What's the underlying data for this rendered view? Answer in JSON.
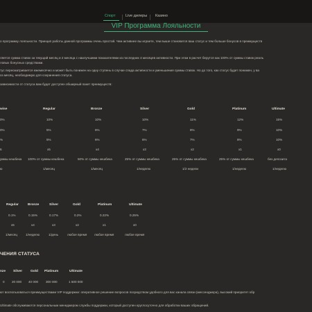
{
  "nav": {
    "items": [
      {
        "label": "Спорт",
        "active": true
      },
      {
        "label": "Live дилеры",
        "active": false
      },
      {
        "label": "Казино",
        "active": false
      }
    ]
  },
  "page": {
    "title": "VIP Программа Лояльности",
    "intro": "о программу лояльности. Принцип работы данной программы очень простой. Чем активнее вы играете, тем выше становится ваш статус и тем больше бонусов в преимуществ",
    "para2_line1": "ляется сумма ставок за текущий месяц и 2 месяца с наилучшими показателями из последних 4 месяцев активности. При этом в расчет берутся как 100% от суммы ставок реаль",
    "para2_line2": "ловых бонусных средствами.",
    "para3_line1": "тус пересматривается ежемесячно и может быть понижен на одну ступень в случае спада активности и уменьшения суммы ставок. Но до того, как статус будет понижен, у ва",
    "para3_line2": "оз месяц, необходимую для сохранения статуса.",
    "para4": "зависимости от статуса вам будет доступен обширный пакет преимуществ:"
  },
  "table1": {
    "headers": [
      "wise",
      "Regular",
      "Bronze",
      "Silver",
      "Gold",
      "Platinum",
      "Ultimate"
    ],
    "rows": [
      [
        "0%",
        "10%",
        "10%",
        "10%",
        "11%",
        "12%",
        "15%"
      ],
      [
        "0%",
        "5%",
        "6%",
        "7%",
        "8%",
        "9%",
        "10%"
      ],
      [
        "%",
        "5%",
        "6%",
        "6%",
        "7%",
        "8%",
        "10%"
      ],
      [
        "6",
        "x5",
        "x4",
        "x3",
        "x2",
        "x1",
        "x0"
      ],
      [
        "уммы кешбека",
        "100% от суммы кешбека",
        "50% от суммы кешбека",
        "25% от суммы кешбека",
        "25% от суммы кешбека",
        "25% от суммы кешбека",
        "без депозита"
      ],
      [
        "ю",
        "1/месяц",
        "1/месяц",
        "1/неделю",
        "1/2 недели",
        "1/неделю",
        "1/неделю"
      ]
    ]
  },
  "table2": {
    "headers": [
      "Regular",
      "Bronze",
      "Silver",
      "Gold",
      "Platinum",
      "Ultimate"
    ],
    "rows": [
      [
        "0.1%",
        "0.15%",
        "0.17%",
        "0.2%",
        "0.22%",
        "0.25%"
      ],
      [
        "x5",
        "x4",
        "x3",
        "x2",
        "x1",
        "x0"
      ],
      [
        "1/месяц",
        "1/неделю",
        "1/день",
        "любое время",
        "любое время",
        "любое время"
      ]
    ]
  },
  "section": {
    "heading": "ЧЕНИЯ СТАТУСА",
    "headers": [
      "nze",
      "Silver",
      "Gold",
      "Platinum",
      "Ultimate"
    ],
    "values": [
      "0",
      "20 000",
      "40 000",
      "300 000",
      "1 500 000"
    ],
    "note1": "ют воспользоваться преимуществами VIP поддержки: оперативное решение вопросов посредством удобного для вас канала связи (мессенджера), высокий приоритет обр",
    "note2": "Ultimate обслуживаются персональным менеджером службы поддержки, который доступен круглосуточно для обработки ваших обращений."
  },
  "colors": {
    "accent": "#3fb37a",
    "background": "#2a2826",
    "header": "#191715"
  }
}
